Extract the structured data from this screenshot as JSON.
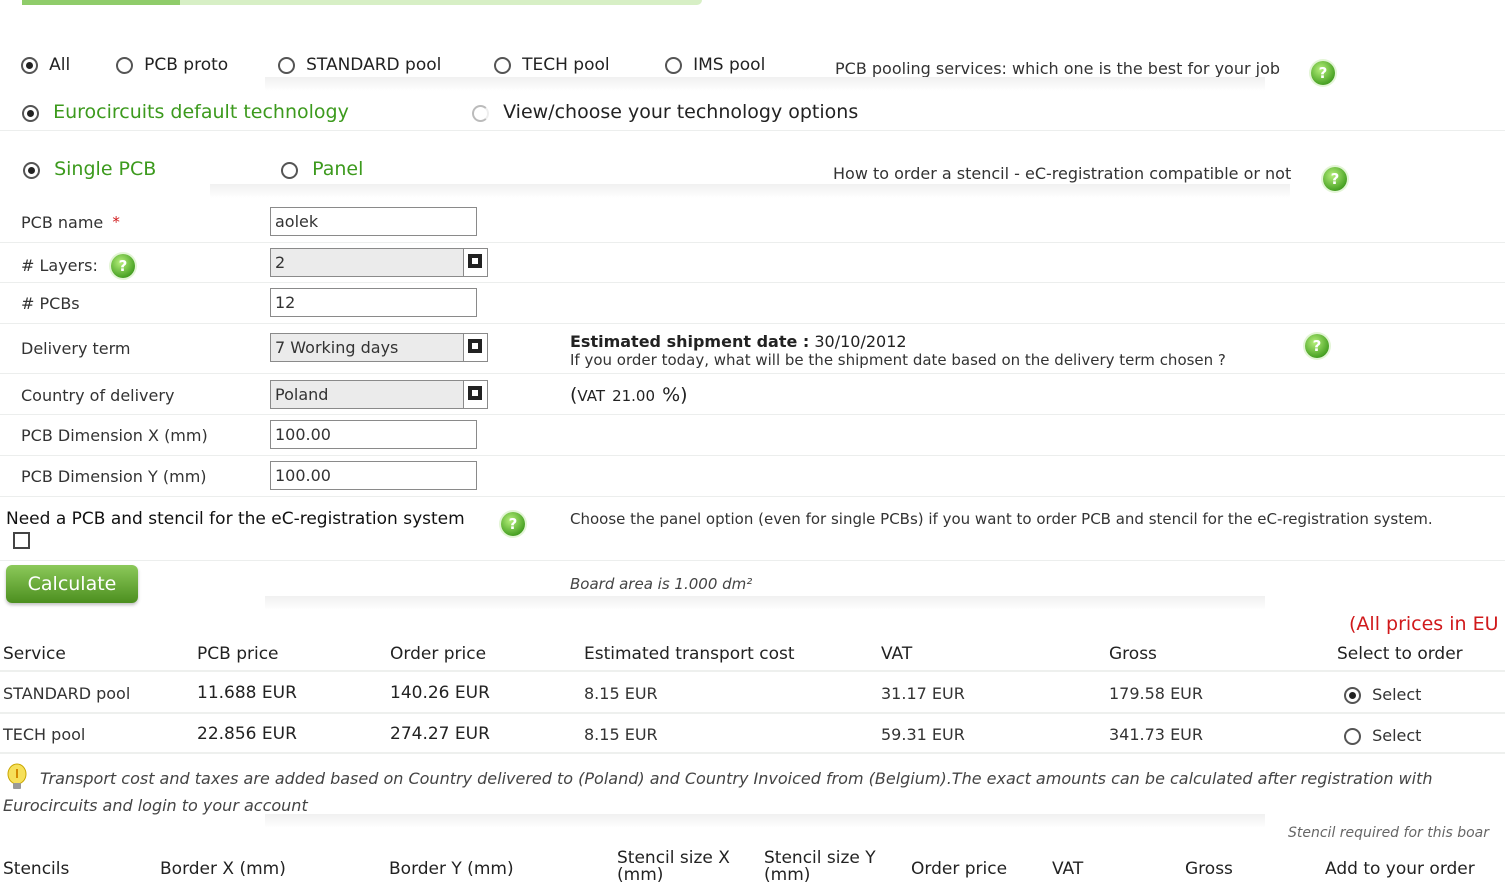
{
  "service_filter": {
    "options": [
      "All",
      "PCB proto",
      "STANDARD pool",
      "TECH pool",
      "IMS pool"
    ],
    "selected": "All",
    "help_text": "PCB pooling services: which one is the best for your job"
  },
  "technology": {
    "default_label": "Eurocircuits default technology",
    "options_label": "View/choose your technology options"
  },
  "pcb_type": {
    "single_label": "Single PCB",
    "panel_label": "Panel",
    "help_text": "How to order a stencil - eC-registration compatible or not"
  },
  "form": {
    "pcb_name_label": "PCB name",
    "required_mark": "*",
    "pcb_name_value": "aolek",
    "layers_label": "# Layers:",
    "layers_value": "2",
    "pcbs_label": "# PCBs",
    "pcbs_value": "12",
    "delivery_label": "Delivery term",
    "delivery_value": "7 Working days",
    "country_label": "Country of delivery",
    "country_value": "Poland",
    "dim_x_label": "PCB Dimension X (mm)",
    "dim_x_value": "100.00",
    "dim_y_label": "PCB Dimension Y (mm)",
    "dim_y_value": "100.00",
    "ec_label": "Need a PCB and stencil for the eC-registration system"
  },
  "shipment": {
    "title": "Estimated shipment date :",
    "date": "30/10/2012",
    "note": "If you order today, what will be the shipment date based on the delivery term chosen ?"
  },
  "vat": {
    "open": "(",
    "prefix": "VAT",
    "value": "21.00",
    "suffix": "%)"
  },
  "panel_hint": "Choose the panel option (even for single PCBs) if you want to order PCB and stencil for the eC-registration system.",
  "calculate_label": "Calculate",
  "board_area": "Board area is 1.000 dm²",
  "prices_note": "(All prices in EU",
  "prices_table": {
    "headers": [
      "Service",
      "PCB price",
      "Order price",
      "Estimated transport cost",
      "VAT",
      "Gross",
      "Select to order"
    ],
    "rows": [
      {
        "service": "STANDARD pool",
        "pcb_price": "11.688 EUR",
        "order_price": "140.26 EUR",
        "transport": "8.15 EUR",
        "vat": "31.17 EUR",
        "gross": "179.58 EUR",
        "select": "Select",
        "selected": true
      },
      {
        "service": "TECH pool",
        "pcb_price": "22.856 EUR",
        "order_price": "274.27 EUR",
        "transport": "8.15 EUR",
        "vat": "59.31 EUR",
        "gross": "341.73 EUR",
        "select": "Select",
        "selected": false
      }
    ]
  },
  "transport_note_line1": "Transport cost and taxes are added based on Country delivered to (Poland) and Country Invoiced from (Belgium).The exact amounts can be calculated after registration with",
  "transport_note_line2": "Eurocircuits and login to your account",
  "stencil_required": "Stencil required for this boar",
  "stencil_table": {
    "headers": [
      "Stencils",
      "Border X (mm)",
      "Border Y (mm)",
      "Stencil size X (mm)",
      "Stencil size Y (mm)",
      "Order price",
      "VAT",
      "Gross",
      "Add to your order"
    ]
  },
  "colors": {
    "accent_green": "#3c9a1d",
    "price_red": "#d0191b"
  }
}
